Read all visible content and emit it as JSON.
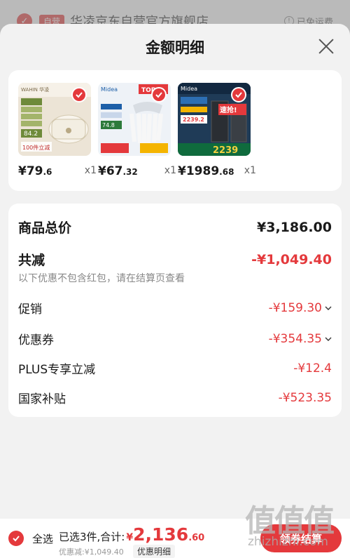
{
  "background": {
    "badge": "自营",
    "store_name": "华凌京东自营官方旗舰店",
    "shipping": "已免运费"
  },
  "sheet": {
    "title": "金额明细"
  },
  "products": [
    {
      "price_int": "¥79",
      "price_dec": ".6",
      "qty": "x1",
      "image_text": "84.2",
      "brand": "WAHIN"
    },
    {
      "price_int": "¥67",
      "price_dec": ".32",
      "qty": "x1",
      "image_text": "TOP1",
      "brand": "Midea"
    },
    {
      "price_int": "¥1989",
      "price_dec": ".68",
      "qty": "x1",
      "image_text": "2239",
      "brand": "Midea"
    }
  ],
  "details": {
    "total_label": "商品总价",
    "total_value": "¥3,186.00",
    "reduce_label": "共减",
    "reduce_value": "-¥1,049.40",
    "note": "以下优惠不包含红包，请在结算页查看",
    "items": [
      {
        "label": "促销",
        "value": "-¥159.30"
      },
      {
        "label": "优惠券",
        "value": "-¥354.35"
      },
      {
        "label": "PLUS专享立减",
        "value": "-¥12.4"
      },
      {
        "label": "国家补贴",
        "value": "-¥523.35"
      }
    ]
  },
  "bottom": {
    "select_all": "全选",
    "summary": "已选3件,合计:",
    "currency": "¥",
    "total_int": "2,136",
    "total_dec": ".60",
    "discount": "优惠减:¥1,049.40",
    "detail_link": "优惠明细",
    "checkout": "领券结算"
  },
  "watermark": {
    "logo": "值值值",
    "url": "zhizhizhi.com"
  },
  "colors": {
    "accent": "#e4393c",
    "background": "#f2f2f2",
    "card": "#ffffff"
  }
}
